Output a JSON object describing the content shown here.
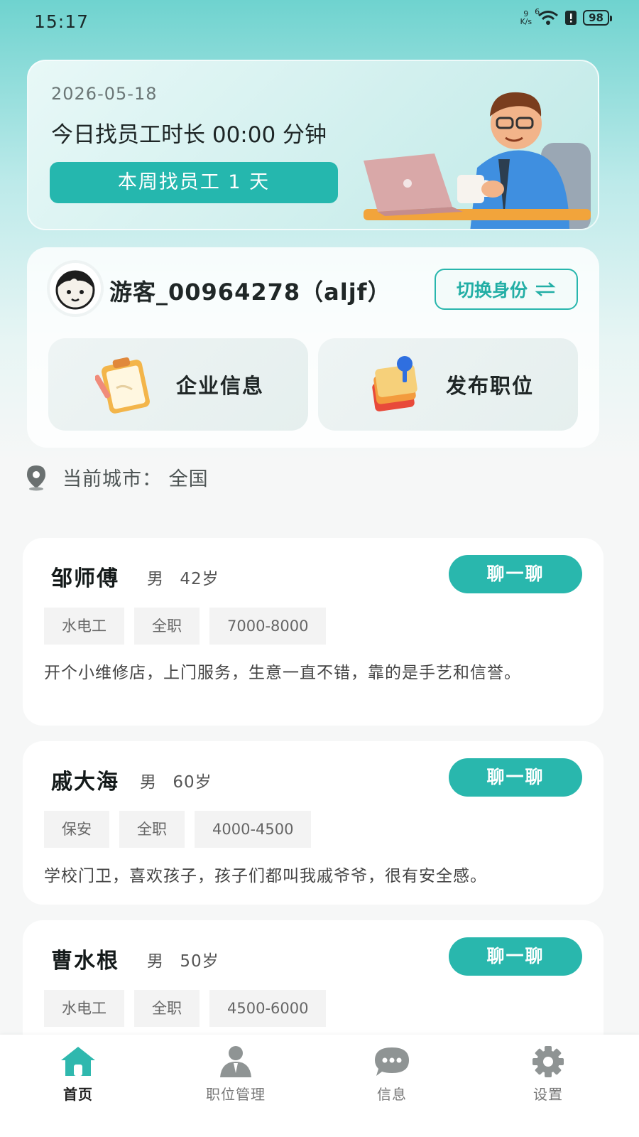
{
  "status_bar": {
    "time": "15:17",
    "net_speed_value": "9",
    "net_speed_unit": "K/s",
    "wifi_badge": "6",
    "battery": "98"
  },
  "banner": {
    "date": "2026-05-18",
    "duration_text": "今日找员工时长 00:00 分钟",
    "week_text": "本周找员工 1 天"
  },
  "profile": {
    "user_name": "游客_00964278（aljf）",
    "switch_label": "切换身份",
    "actions": [
      {
        "label": "企业信息",
        "icon": "clipboard-icon"
      },
      {
        "label": "发布职位",
        "icon": "pinned-notes-icon"
      }
    ]
  },
  "city": {
    "label": "当前城市：",
    "value": "全国"
  },
  "workers": [
    {
      "name": "邹师傅",
      "gender": "男",
      "age": "42岁",
      "chat_label": "聊一聊",
      "tags": [
        "水电工",
        "全职",
        "7000-8000"
      ],
      "description": "开个小维修店，上门服务，生意一直不错，靠的是手艺和信誉。"
    },
    {
      "name": "戚大海",
      "gender": "男",
      "age": "60岁",
      "chat_label": "聊一聊",
      "tags": [
        "保安",
        "全职",
        "4000-4500"
      ],
      "description": "学校门卫，喜欢孩子，孩子们都叫我戚爷爷，很有安全感。"
    },
    {
      "name": "曹水根",
      "gender": "男",
      "age": "50岁",
      "chat_label": "聊一聊",
      "tags": [
        "水电工",
        "全职",
        "4500-6000"
      ]
    }
  ],
  "nav": [
    {
      "label": "首页",
      "icon": "home-icon",
      "active": true
    },
    {
      "label": "职位管理",
      "icon": "person-tie-icon",
      "active": false
    },
    {
      "label": "信息",
      "icon": "chat-bubble-icon",
      "active": false
    },
    {
      "label": "设置",
      "icon": "gear-icon",
      "active": false
    }
  ],
  "colors": {
    "accent": "#29b7ad",
    "nav_active": "#2fb8ae",
    "nav_inactive": "#8f9494"
  }
}
